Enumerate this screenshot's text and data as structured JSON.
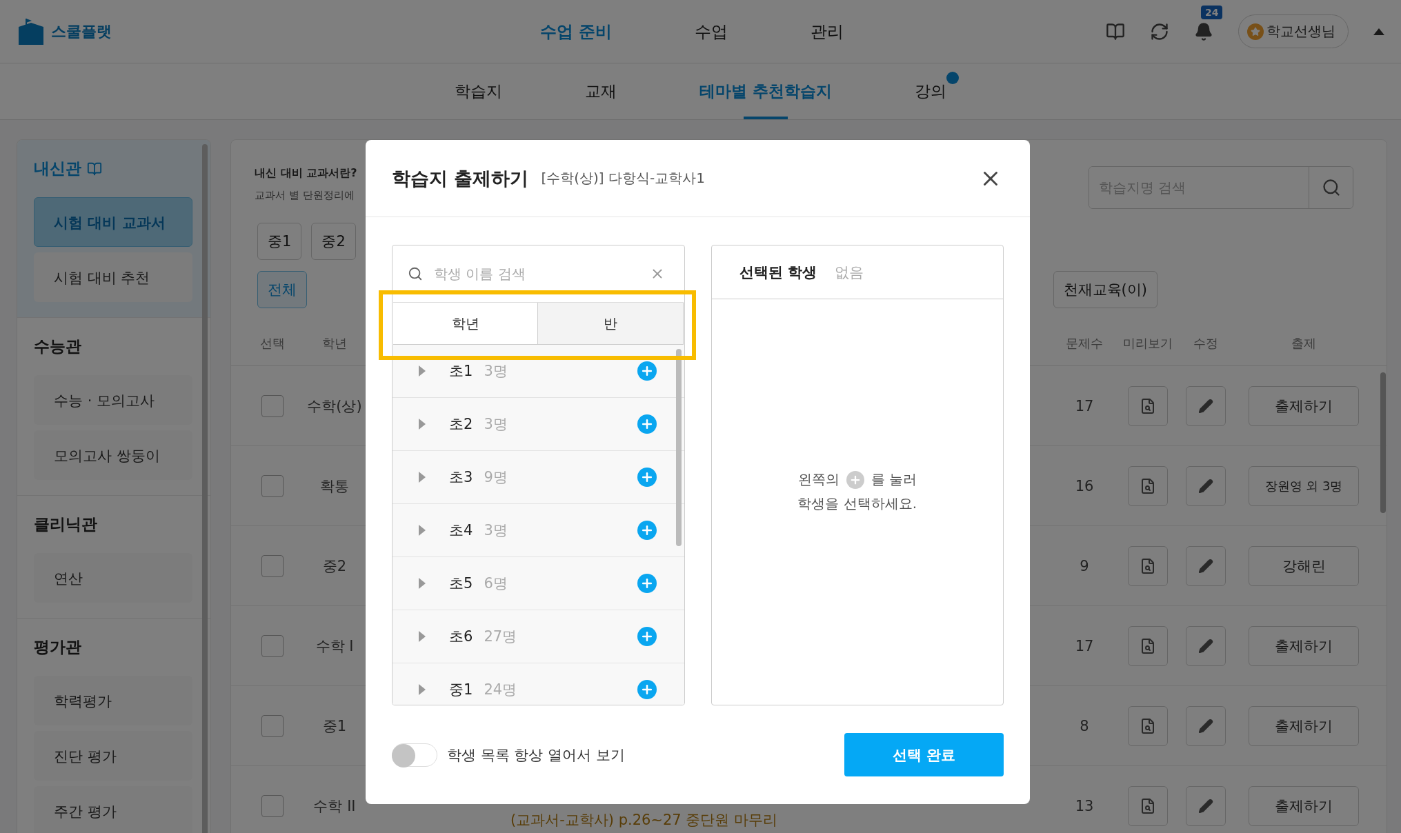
{
  "header": {
    "logo": "스쿨플랫",
    "nav": [
      {
        "label": "수업 준비",
        "selected": true
      },
      {
        "label": "수업",
        "selected": false
      },
      {
        "label": "관리",
        "selected": false
      }
    ],
    "notification_count": "24",
    "user": "학교선생님"
  },
  "subnav": [
    {
      "label": "학습지",
      "selected": false,
      "new_badge": false
    },
    {
      "label": "교재",
      "selected": false,
      "new_badge": false
    },
    {
      "label": "테마별 추천학습지",
      "selected": true,
      "new_badge": false
    },
    {
      "label": "강의",
      "selected": false,
      "new_badge": true
    }
  ],
  "sidebar": [
    {
      "title": "내신관",
      "highlighted": true,
      "items": [
        {
          "label": "시험 대비 교과서",
          "selected": true
        },
        {
          "label": "시험 대비 추천",
          "selected": false
        }
      ]
    },
    {
      "title": "수능관",
      "highlighted": false,
      "items": [
        {
          "label": "수능 · 모의고사",
          "selected": false
        },
        {
          "label": "모의고사 쌍둥이",
          "selected": false
        }
      ]
    },
    {
      "title": "클리닉관",
      "highlighted": false,
      "items": [
        {
          "label": "연산",
          "selected": false
        }
      ]
    },
    {
      "title": "평가관",
      "highlighted": false,
      "items": [
        {
          "label": "학력평가",
          "selected": false
        },
        {
          "label": "진단 평가",
          "selected": false
        },
        {
          "label": "주간 평가",
          "selected": false
        }
      ]
    }
  ],
  "content": {
    "info_title": "내신 대비 교과서란?",
    "info_text": "교과서 별 단원정리에",
    "search_placeholder": "학습지명 검색",
    "grade_filters": [
      {
        "label": "중1",
        "selected": false
      },
      {
        "label": "중2",
        "selected": false
      }
    ],
    "publisher_filters": [
      {
        "label": "전체",
        "selected": true
      },
      {
        "label": "천재교육(이)",
        "selected": false
      }
    ],
    "columns": {
      "select": "선택",
      "grade": "학년",
      "count": "문제수",
      "preview": "미리보기",
      "edit": "수정",
      "assign": "출제"
    },
    "rows": [
      {
        "checked": false,
        "grade": "수학(상)",
        "count": "17",
        "assign": "출제하기"
      },
      {
        "checked": false,
        "grade": "확통",
        "count": "16",
        "assign": "장원영 외 3명"
      },
      {
        "checked": false,
        "grade": "중2",
        "count": "9",
        "assign": "강해린"
      },
      {
        "checked": false,
        "grade": "수학 I",
        "count": "17",
        "assign": "출제하기"
      },
      {
        "checked": false,
        "grade": "중1",
        "count": "8",
        "assign": "출제하기"
      },
      {
        "checked": false,
        "grade": "수학 II",
        "count": "13",
        "assign": "출제하기",
        "title": "(교과서-교학사) p.26~27 중단원 마무리"
      }
    ]
  },
  "modal": {
    "title": "학습지 출제하기",
    "subtitle": "[수학(상)] 다항식-교학사1",
    "search_placeholder": "학생 이름 검색",
    "tabs": [
      {
        "label": "학년",
        "selected": true
      },
      {
        "label": "반",
        "selected": false
      }
    ],
    "groups": [
      {
        "label": "초1",
        "count": "3명"
      },
      {
        "label": "초2",
        "count": "3명"
      },
      {
        "label": "초3",
        "count": "9명"
      },
      {
        "label": "초4",
        "count": "3명"
      },
      {
        "label": "초5",
        "count": "6명"
      },
      {
        "label": "초6",
        "count": "27명"
      },
      {
        "label": "중1",
        "count": "24명"
      }
    ],
    "selected_title": "선택된 학생",
    "selected_value": "없음",
    "hint_before": "왼쪽의",
    "hint_after": "를 눌러",
    "hint_line2": "학생을 선택하세요.",
    "toggle": {
      "label": "학생 목록 항상 열어서 보기",
      "on": false
    },
    "confirm": "선택 완료"
  }
}
